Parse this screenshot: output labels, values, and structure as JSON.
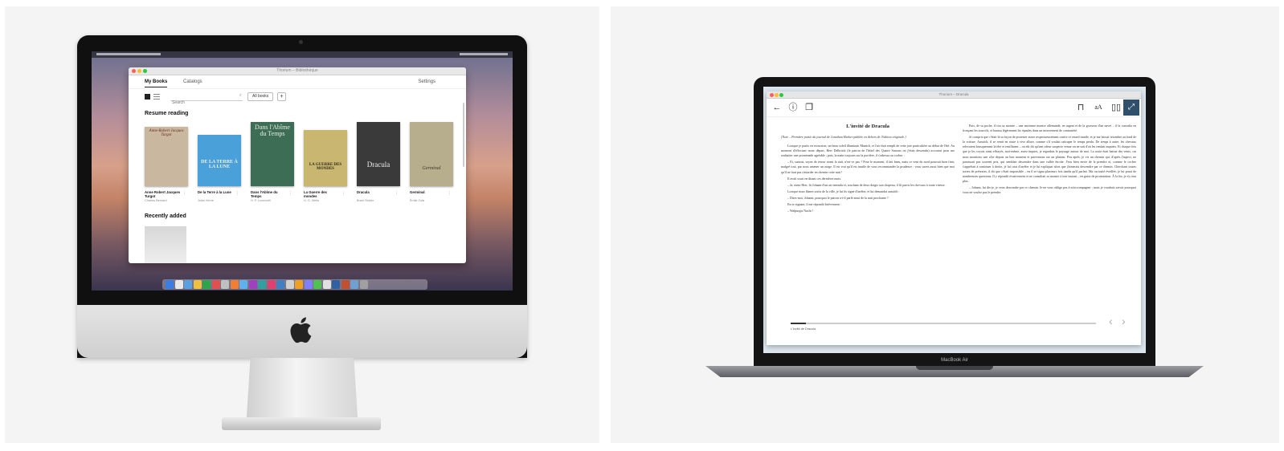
{
  "imac": {
    "window_title": "Thorium – Bibliothèque",
    "tabs": [
      {
        "label": "My Books",
        "active": true
      },
      {
        "label": "Catalogs",
        "active": false
      }
    ],
    "settings_label": "Settings",
    "search_placeholder": "Search",
    "all_books_button": "All books",
    "add_button": "+",
    "resume_heading": "Resume reading",
    "recent_heading": "Recently added",
    "books": [
      {
        "title": "Anne Robert Jacques Turgot",
        "author": "Charles Bernard",
        "cover_text": "Anne-Robert Jacques Turgot",
        "cover_bg": "#c9b7a0",
        "cover_fg": "#6b2a1a"
      },
      {
        "title": "De la Terre à la Lune",
        "author": "Jules Verne",
        "cover_text": "DE LA TERRE À LA LUNE",
        "cover_bg": "#4aa0d8",
        "cover_fg": "#f2f2e6"
      },
      {
        "title": "Dans l'Abîme du Temps",
        "author": "H. P. Lovecraft",
        "cover_text": "Dans l'Abîme du Temps",
        "cover_bg": "#3e6d55",
        "cover_fg": "#e8eee6"
      },
      {
        "title": "La Guerre des mondes",
        "author": "H. G. Wells",
        "cover_text": "LA GUERRE DES MONDES",
        "cover_bg": "#c9b670",
        "cover_fg": "#2d2a1a"
      },
      {
        "title": "Dracula",
        "author": "Bram Stoker",
        "cover_text": "Dracula",
        "cover_bg": "#3a3a3a",
        "cover_fg": "#f0f0f0"
      },
      {
        "title": "Germinal",
        "author": "Émile Zola",
        "cover_text": "Germinal",
        "cover_bg": "#b7ae8e",
        "cover_fg": "#3a3524"
      }
    ],
    "dock_colors": [
      "#3b7de0",
      "#e8e8e8",
      "#5aa0e0",
      "#f0c040",
      "#2ea44f",
      "#e05050",
      "#c0c0c0",
      "#f08030",
      "#60b0f0",
      "#a040c0",
      "#30a0a0",
      "#e04070",
      "#4080c0",
      "#d0d0d0",
      "#f0a020",
      "#8080ff",
      "#50c050",
      "#e0e0e0",
      "#3060a0",
      "#c05030",
      "#70a0d0",
      "#a0a0a0"
    ]
  },
  "macbook": {
    "window_title": "Thorium – Dracula",
    "label": "MacBook Air",
    "chapter_title": "L'invité de Dracula",
    "epigraph": "[Note – Première partie du journal de Jonathan Harker publiée en dehors de l'édition originale.]",
    "left_paragraphs": [
      "Lorsque je partis en excursion, un beau soleil illuminait Munich, et l'air était rempli de cette joie particulière au début de l'été. Au moment d'effectuer notre départ, Herr Delbrück (le patron de l'hôtel des Quatre Saisons où j'étais descendu) accourut pour me souhaiter une promenade agréable ; puis, la main toujours sur la portière, il s'adressa au cocher :",
      "– Et, surtout, soyez de retour avant la nuit, n'est-ce pas ? Pour le moment, il fait beau, mais ce vent du nord pourrait bien finir, malgré tout, par nous amener un orage. Il est vrai qu'il est inutile de vous recommander la prudence : vous savez aussi bien que moi qu'il ne faut pas s'attarder en chemin cette nuit !",
      "Il avait souri en disant ces dernières mots.",
      "– Ja, mein Herr, fit Johann d'un air entendu et, touchant de deux doigts son chapeau, il fit partir les chevaux à toute vitesse.",
      "Lorsque nous fûmes sortis de la ville, je lui fis signe d'arrêter, et lui demandai aussitôt :",
      "– Dites-moi, Johann, pourquoi le patron a-t-il parlé ainsi de la nuit prochaine ?",
      "En se signant, il me répondit brièvement :",
      "– Walpurgis Nacht !"
    ],
    "right_paragraphs": [
      "Puis, de sa poche, il tira sa montre – une ancienne montre allemande, en argent et de la grosseur d'un navet – il la consulta en fronçant les sourcils, et haussa légèrement les épaules dans un mouvement de contrariété.",
      "Je compris que c'était là sa façon de protester assez respectueusement contre ce retard inutile, et je me laissai retomber au fond de la voiture. Aussitôt, il se remit en route à vive allure, comme s'il voulait rattraper le temps perdu. De temps à autre, les chevaux relevaient brusquement la tête et reniflaient – on eût dit qu'une odeur suspecte venue on ne sait d'où les rendait inquiets. Et chaque fois que je les voyais ainsi effrayés, moi-même, assez inquiet, je regardais le paysage autour de moi. La route était battue des vents, car nous montions une côte depuis un bon moment et parvenions sur un plateau. Peu après, je vis un chemin qui, d'après l'aspect, ne paraissait pas souvent pris, qui semblait descendre dans une vallée étroite. J'eus bien envie de le prendre et, comme le cocher s'apprêtait à continuer à droite, je lui criai d'arrêter et je lui expliquai alors que j'aimerais descendre par ce chemin. Cherchant toutes sortes de prétextes, il dit que c'était impossible – en il se signa plusieurs fois tandis qu'il parlait. Ma curiosité éveillée, je lui posai de nombreuses questions. Il y répondit évasivement et ne consultait sa montre à tout instant – en guise de protestation. À la fin, je n'y tins plus.",
      "– Johann, lui dis-je, je veux descendre par ce chemin. Je ne vous oblige pas à m'accompagner ; mais je voudrais savoir pourquoi vous ne voulez pas le prendre."
    ],
    "progress_fraction": 0.05,
    "current_chapter": "L'invité de Dracula"
  }
}
